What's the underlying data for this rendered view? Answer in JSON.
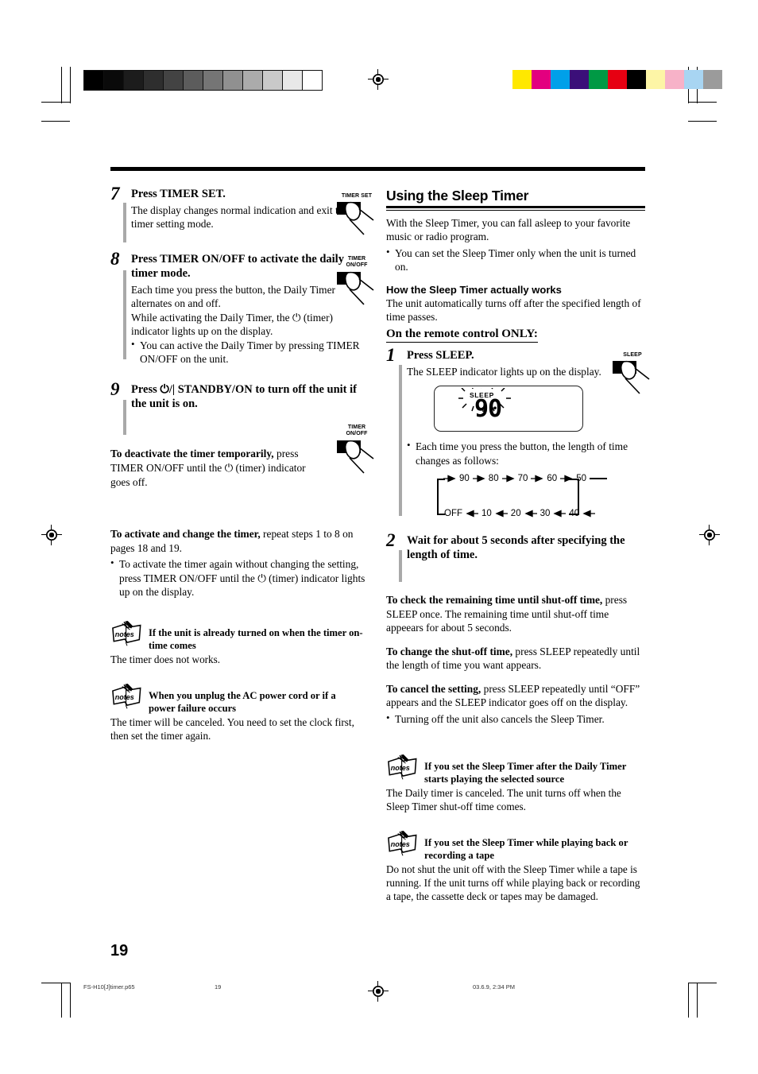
{
  "page": {
    "number": "19",
    "footer": {
      "filename": "FS-H10[J]timer.p65",
      "page": "19",
      "timestamp": "03.6.9, 2:34 PM"
    }
  },
  "printmarks": {
    "gray_wedge": [
      "#000000",
      "#0a0a0a",
      "#1c1c1c",
      "#2e2e2e",
      "#434343",
      "#5c5c5c",
      "#757575",
      "#909090",
      "#ababab",
      "#c9c9c9",
      "#e8e8e8",
      "#ffffff"
    ],
    "color_bars": [
      "#ffe800",
      "#e3007f",
      "#00a0e9",
      "#3b0f79",
      "#009944",
      "#e60012",
      "#000000",
      "#fdf5a6",
      "#f7b2c8",
      "#a8d5f2",
      "#9b9b9b"
    ]
  },
  "left_column": {
    "steps": [
      {
        "number": "7",
        "title": "Press TIMER SET.",
        "body": "The display changes normal indication and exit the timer setting mode.",
        "button_label": "TIMER SET"
      },
      {
        "number": "8",
        "title": "Press TIMER ON/OFF to activate the daily timer mode.",
        "body_1": "Each time you press the button, the Daily Timer alternates on and off.",
        "body_2": "While activating the Daily Timer, the ⏻ (timer) indicator lights up on the display.",
        "bullet": "You can active the Daily Timer by pressing TIMER ON/OFF on the unit.",
        "button_label_line1": "TIMER",
        "button_label_line2": "ON/OFF"
      },
      {
        "number": "9",
        "title": "Press ⏻/| STANDBY/ON to turn off the unit if the unit is on."
      }
    ],
    "deactivate": {
      "lead": "To deactivate the timer temporarily,",
      "rest": " press TIMER ON/OFF until the ⏻ (timer) indicator goes off.",
      "button_label_line1": "TIMER",
      "button_label_line2": "ON/OFF"
    },
    "activate_change": {
      "lead": "To activate and change the timer,",
      "rest": " repeat steps 1 to 8 on pages 18 and 19.",
      "step_from": "1",
      "step_to": "8",
      "bullet": "To activate the timer again without changing the setting, press TIMER ON/OFF until the ⏻ (timer) indicator lights up on the display."
    },
    "notes": [
      {
        "icon": "notes-icon",
        "heading": "If the unit is already turned on when the timer on-time comes",
        "body": "The timer does not works."
      },
      {
        "icon": "notes-icon",
        "heading": "When you unplug the AC power cord or if a power failure occurs",
        "body": "The timer will be canceled. You need to set the clock first, then set the timer again."
      }
    ]
  },
  "right_column": {
    "section_title": "Using the Sleep Timer",
    "intro": "With the Sleep Timer, you can fall asleep to your favorite music or radio program.",
    "intro_bullet": "You can set the Sleep Timer only when the unit is turned on.",
    "how_heading": "How the Sleep Timer actually works",
    "how_body": "The unit automatically turns off after the specified length of time passes.",
    "remote_only": "On the remote control ONLY:",
    "steps": [
      {
        "number": "1",
        "title": "Press SLEEP.",
        "body": "The SLEEP indicator lights up on the display.",
        "button_label": "SLEEP",
        "display": {
          "indicator": "SLEEP",
          "value": "90"
        },
        "bullet": "Each time you press the button, the length of time changes as follows:"
      },
      {
        "number": "2",
        "title": "Wait for about 5 seconds after specifying the length of time."
      }
    ],
    "sequence": {
      "top_row": [
        "90",
        "80",
        "70",
        "60",
        "50"
      ],
      "bottom_row": [
        "OFF",
        "10",
        "20",
        "30",
        "40"
      ]
    },
    "paragraphs": [
      {
        "lead": "To check the remaining time until shut-off time,",
        "rest": " press SLEEP once. The remaining time until shut-off time appeears for about 5 seconds."
      },
      {
        "lead": "To change the shut-off time,",
        "rest": " press SLEEP repeatedly until the length of time you want appears."
      },
      {
        "lead": "To cancel the setting,",
        "rest": " press SLEEP repeatedly until “OFF” appears and the SLEEP indicator goes off on the display."
      }
    ],
    "cancel_bullet": "Turning off the unit also cancels the Sleep Timer.",
    "notes": [
      {
        "icon": "notes-icon",
        "heading": "If you set the Sleep Timer after the Daily Timer starts playing the selected source",
        "body": "The Daily timer is canceled. The unit turns off when the Sleep Timer shut-off time comes."
      },
      {
        "icon": "notes-icon",
        "heading": "If you set the Sleep Timer while playing back or recording a tape",
        "body": "Do not shut the unit off with the Sleep Timer while a tape is running. If the unit turns off while playing back or recording a tape, the cassette deck or tapes may be damaged."
      }
    ]
  }
}
